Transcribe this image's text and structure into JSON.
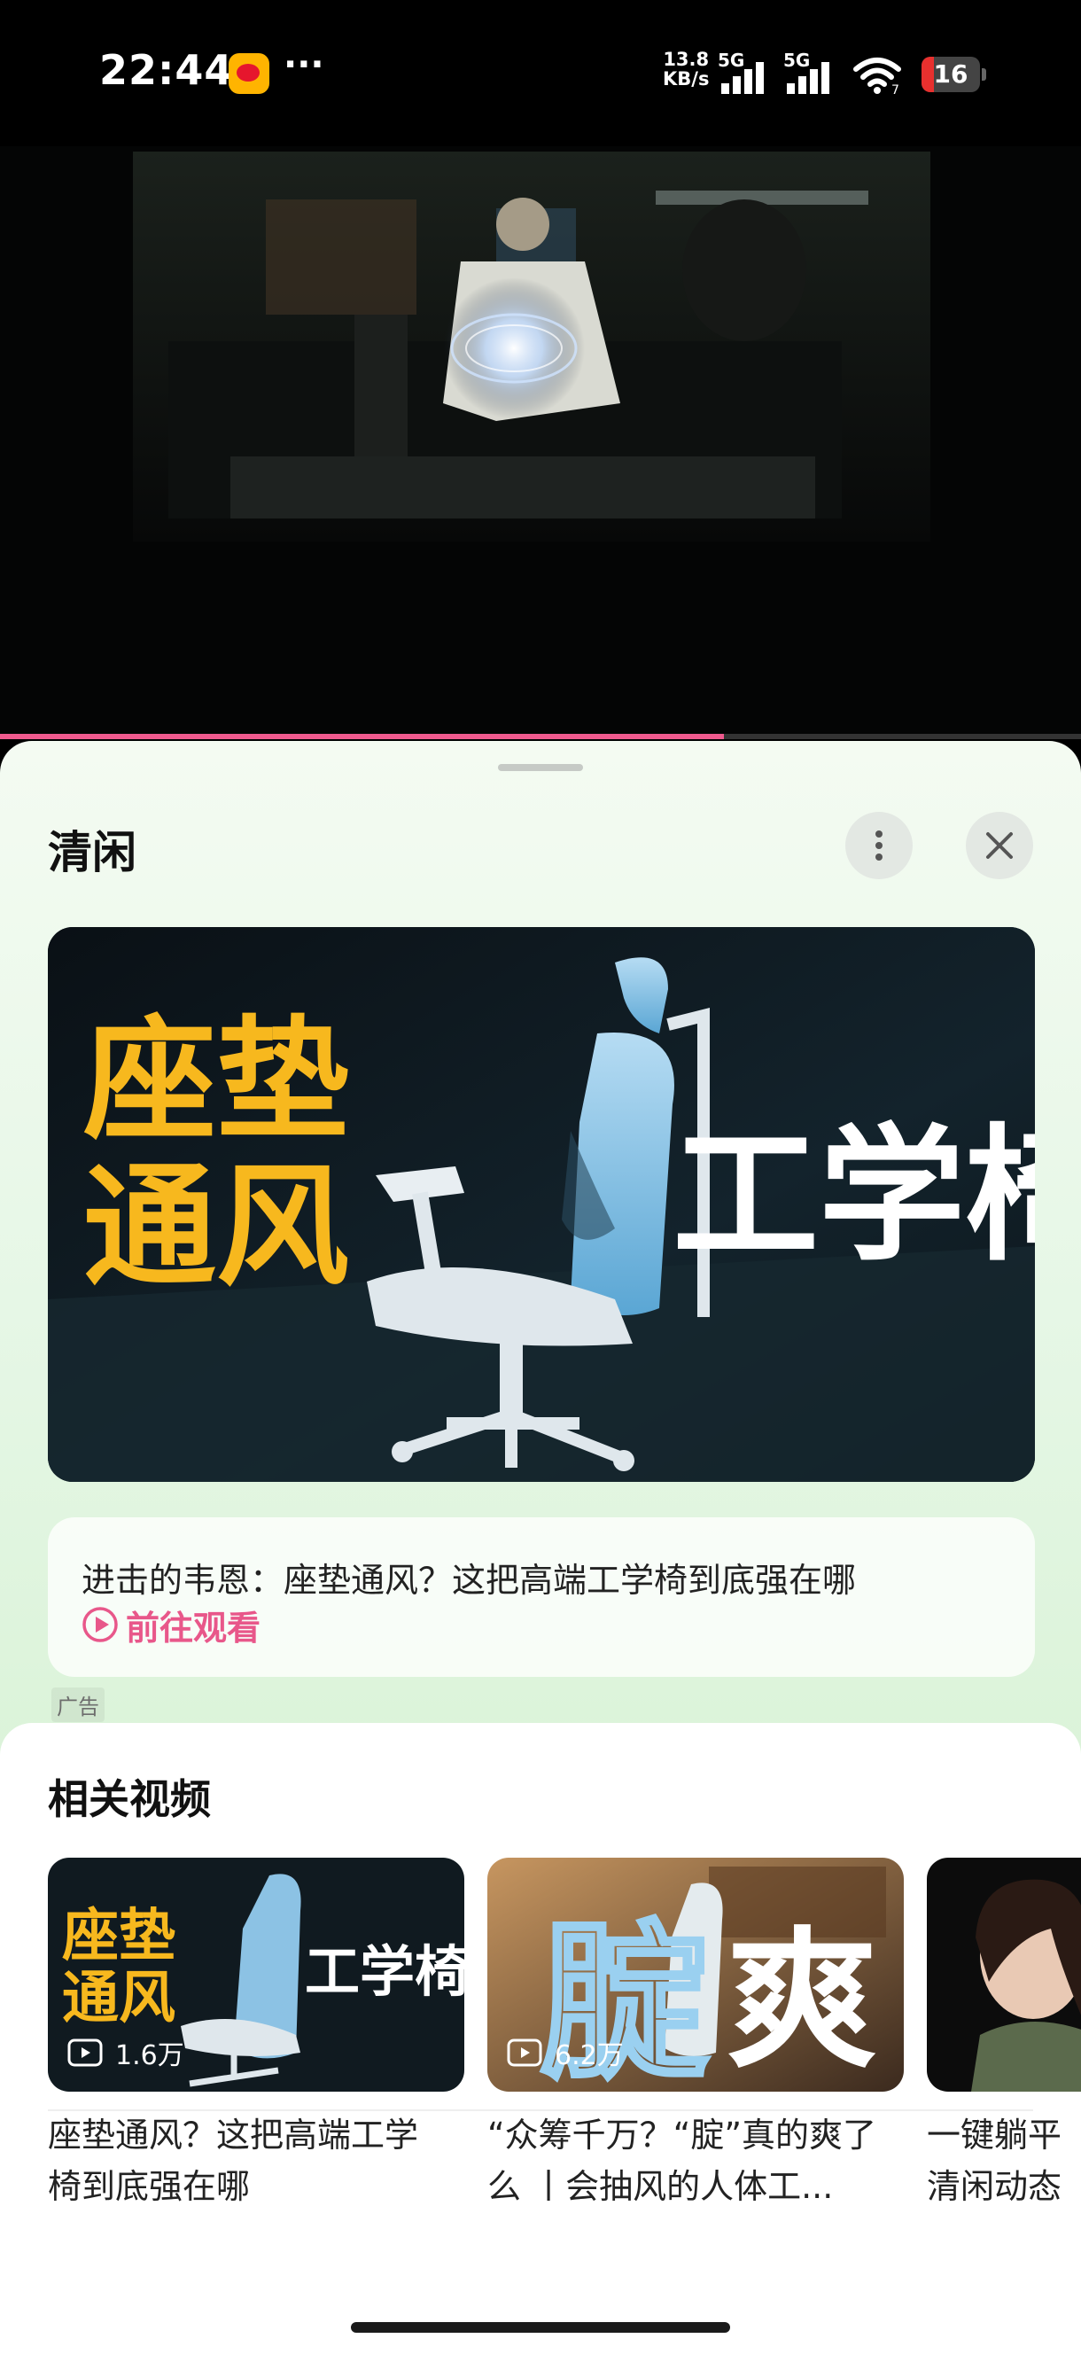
{
  "status_bar": {
    "time": "22:44",
    "app_icon": "weibo-icon",
    "more": "···",
    "net_speed_value": "13.8",
    "net_speed_unit": "KB/s",
    "signal1_label": "5G",
    "signal2_label": "5G",
    "wifi_label": "7",
    "battery": "16"
  },
  "video": {
    "progress_percent": 67,
    "progress_color": "#f05a8e"
  },
  "sheet": {
    "title": "清闲",
    "more_icon": "vertical-dots-icon",
    "close_icon": "close-icon",
    "ad_banner": {
      "yellow_text_line1": "座垫",
      "yellow_text_line2": "通风",
      "white_text": "工学椅"
    },
    "ad_card": {
      "title": "进击的韦恩：座垫通风？这把高端工学椅到底强在哪",
      "cta": "前往观看"
    },
    "ad_label": "广告"
  },
  "related": {
    "title": "相关视频",
    "items": [
      {
        "views": "1.6万",
        "caption": "座垫通风？这把高端工学\n椅到底强在哪",
        "thumb_text_yellow_1": "座垫",
        "thumb_text_yellow_2": "通风",
        "thumb_text_white": "工学椅"
      },
      {
        "views": "6.2万",
        "caption": "“众筹千万？“腚”真的爽了\n么 丨会抽风的人体工...",
        "thumb_text_blue": "腚",
        "thumb_text_white": "爽"
      },
      {
        "views": "",
        "caption": "一键躺平\n清闲动态"
      }
    ]
  },
  "colors": {
    "accent": "#e8578a",
    "sheet_gradient_top": "#f4fbf2",
    "sheet_gradient_bottom": "#cdeec8"
  }
}
